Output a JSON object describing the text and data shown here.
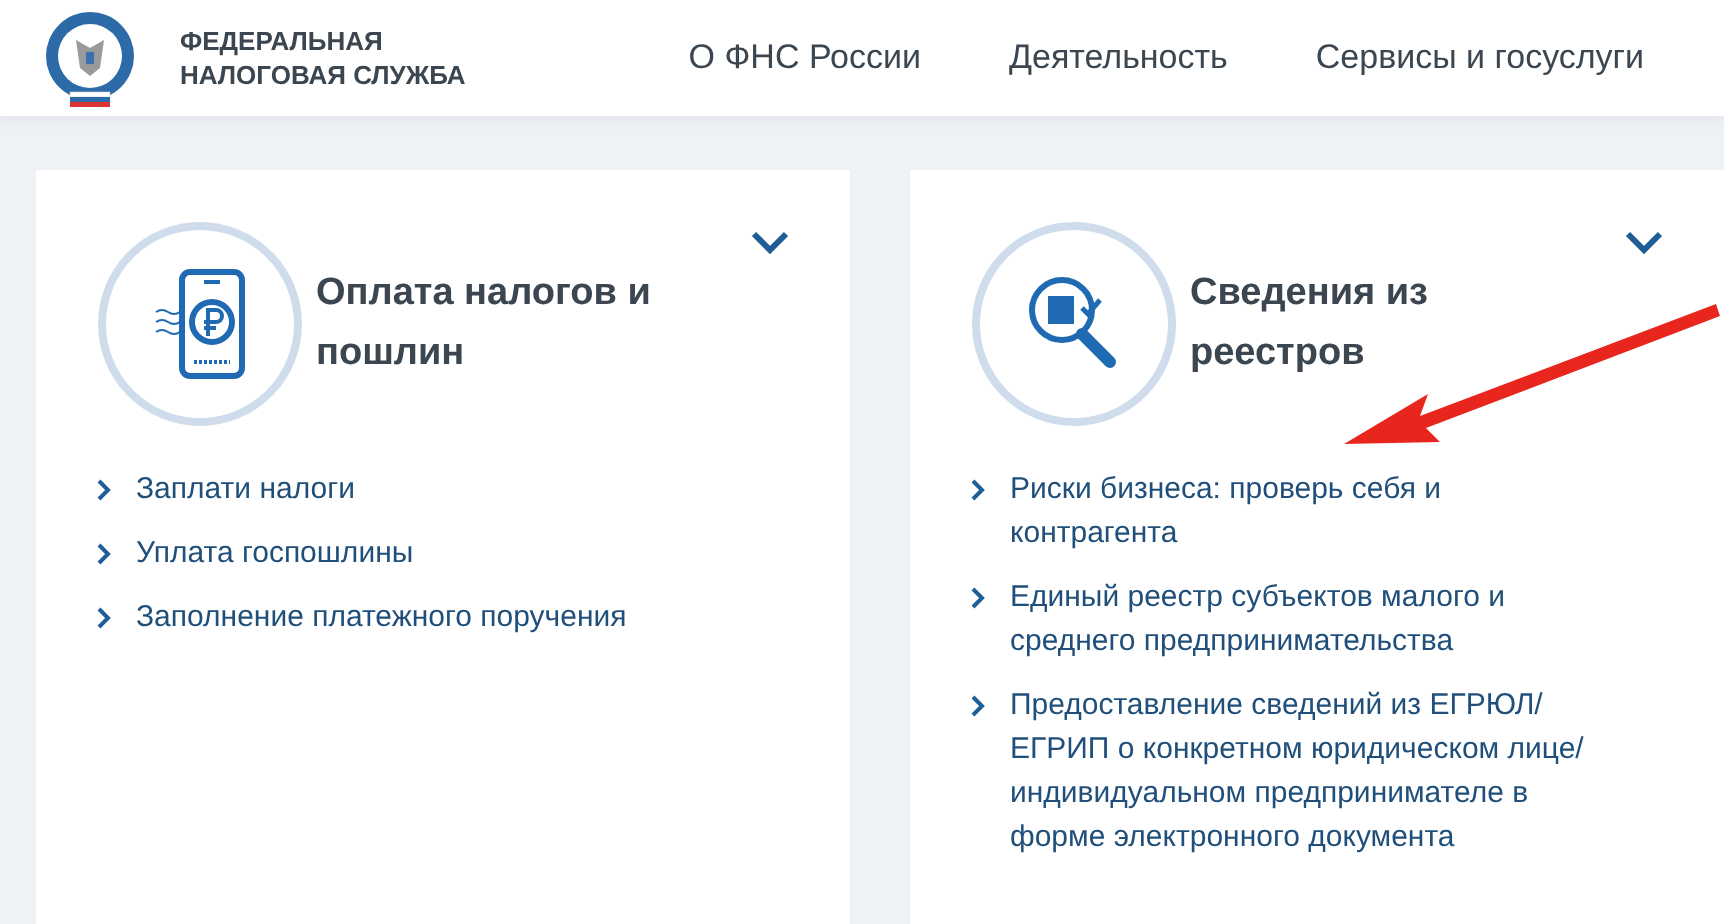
{
  "header": {
    "logo_text": [
      "ФЕДЕРАЛЬНАЯ",
      "НАЛОГОВАЯ СЛУЖБА"
    ],
    "nav": [
      "О ФНС России",
      "Деятельность",
      "Сервисы и госуслуги"
    ]
  },
  "cards": [
    {
      "kind": "payment",
      "title": "Оплата налогов и пошлин",
      "links": [
        "Заплати налоги",
        "Уплата госпошлины",
        "Заполнение платежного поручения"
      ]
    },
    {
      "kind": "registry",
      "title": "Сведения из реестров",
      "links": [
        "Риски бизнеса: проверь себя и контрагента",
        "Единый реестр субъектов малого и среднего предпринимательства",
        "Предоставление сведений из ЕГРЮЛ/ЕГРИП о конкретном юридическом лице/индивидуальном предпринимателе в форме электронного документа"
      ]
    }
  ]
}
